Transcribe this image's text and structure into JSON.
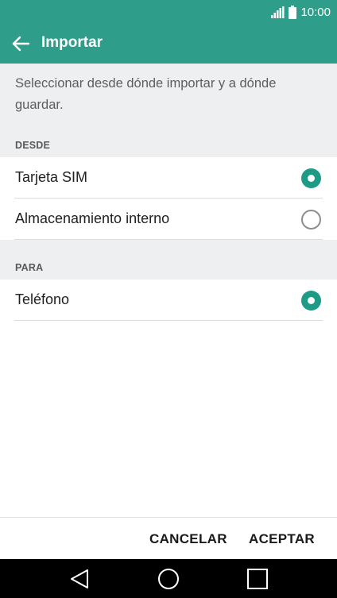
{
  "status_bar": {
    "time": "10:00",
    "icons": [
      "signal-icon",
      "battery-icon"
    ]
  },
  "app_bar": {
    "title": "Importar",
    "back_icon": "back-arrow-icon"
  },
  "intro": {
    "text": "Seleccionar desde dónde importar y a dónde guardar."
  },
  "from_section": {
    "header": "DESDE",
    "options": [
      {
        "label": "Tarjeta SIM",
        "selected": true
      },
      {
        "label": "Almacenamiento interno",
        "selected": false
      }
    ]
  },
  "to_section": {
    "header": "PARA",
    "options": [
      {
        "label": "Teléfono",
        "selected": true
      }
    ]
  },
  "actions": {
    "cancel_label": "CANCELAR",
    "accept_label": "ACEPTAR"
  },
  "nav_bar": {
    "icons": [
      "back-triangle-icon",
      "home-circle-icon",
      "recents-square-icon"
    ]
  },
  "colors": {
    "accent": "#2e9d8a",
    "radio_on": "#1e9b87",
    "band": "#eeeff1"
  }
}
